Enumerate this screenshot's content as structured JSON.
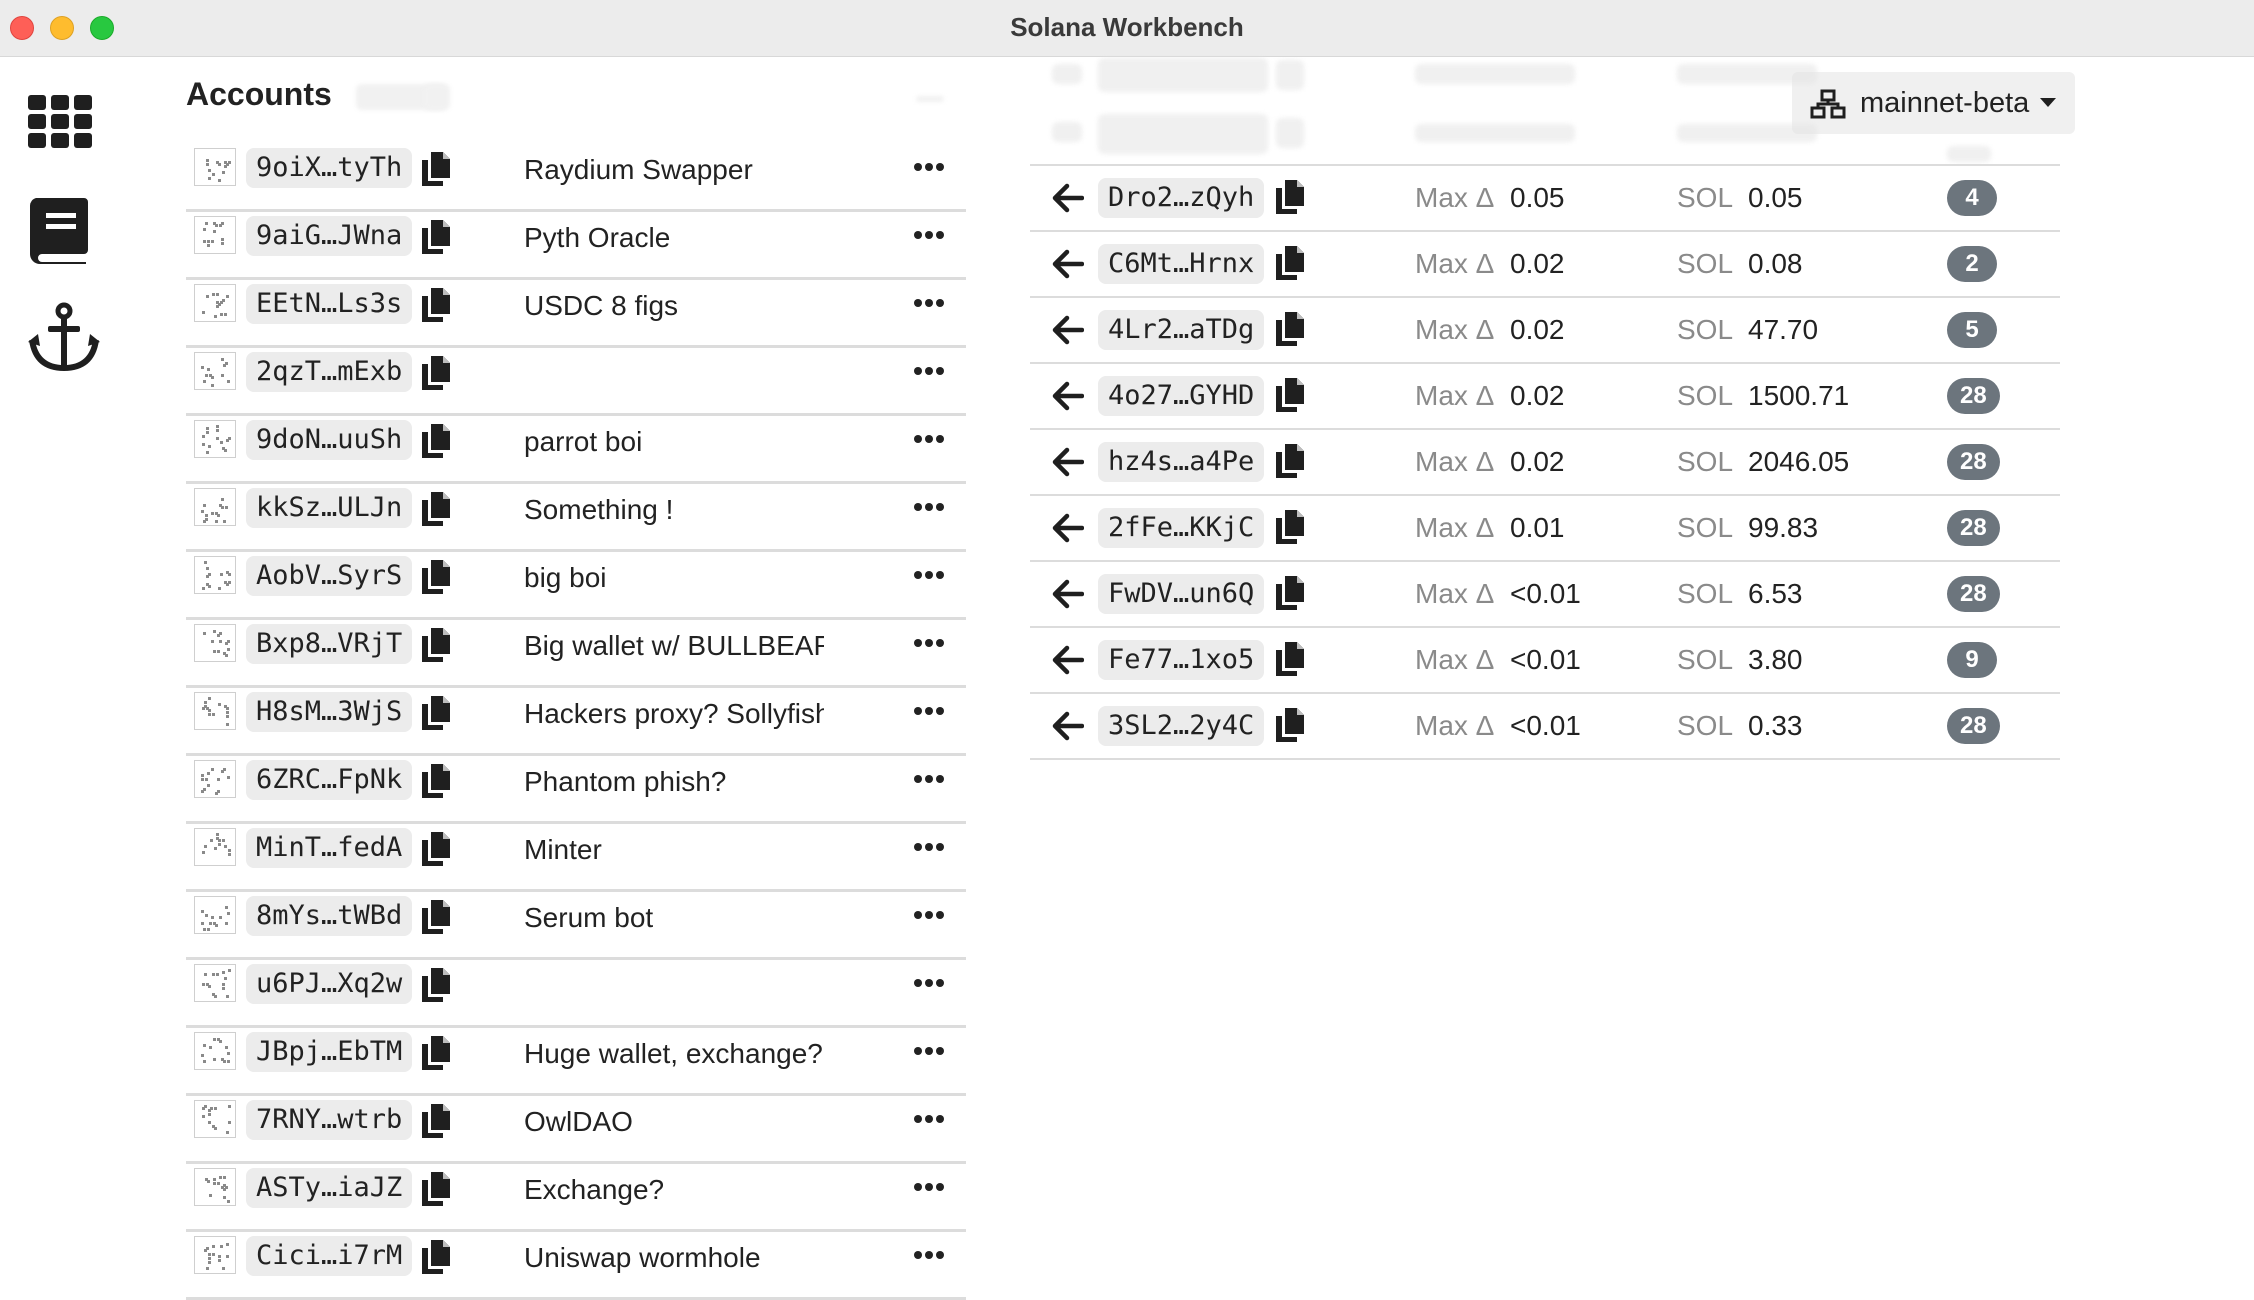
{
  "window": {
    "title": "Solana Workbench"
  },
  "sidebar": {
    "items": [
      {
        "icon": "grid-icon"
      },
      {
        "icon": "book-icon"
      },
      {
        "icon": "anchor-icon"
      }
    ]
  },
  "accounts": {
    "title": "Accounts",
    "rows": [
      {
        "pubkey": "9oiX…tyTh",
        "label": "Raydium Swapper"
      },
      {
        "pubkey": "9aiG…JWna",
        "label": "Pyth Oracle"
      },
      {
        "pubkey": "EEtN…Ls3s",
        "label": "USDC 8 figs"
      },
      {
        "pubkey": "2qzT…mExb",
        "label": ""
      },
      {
        "pubkey": "9doN…uuSh",
        "label": "parrot boi"
      },
      {
        "pubkey": "kkSz…ULJn",
        "label": "Something !"
      },
      {
        "pubkey": "AobV…SyrS",
        "label": "big boi"
      },
      {
        "pubkey": "Bxp8…VRjT",
        "label": "Big wallet w/ BULLBEAR"
      },
      {
        "pubkey": "H8sM…3WjS",
        "label": "Hackers proxy? Sollyfish"
      },
      {
        "pubkey": "6ZRC…FpNk",
        "label": "Phantom phish?"
      },
      {
        "pubkey": "MinT…fedA",
        "label": "Minter"
      },
      {
        "pubkey": "8mYs…tWBd",
        "label": "Serum bot"
      },
      {
        "pubkey": "u6PJ…Xq2w",
        "label": ""
      },
      {
        "pubkey": "JBpj…EbTM",
        "label": "Huge wallet, exchange?"
      },
      {
        "pubkey": "7RNY…wtrb",
        "label": "OwlDAO"
      },
      {
        "pubkey": "ASTy…iaJZ",
        "label": "Exchange?"
      },
      {
        "pubkey": "Cici…i7rM",
        "label": "Uniswap wormhole"
      }
    ]
  },
  "network": {
    "label": "mainnet-beta",
    "icon": "network-icon"
  },
  "transactions": {
    "max_delta_label": "Max Δ",
    "sol_label": "SOL",
    "rows": [
      {
        "pubkey": "Dro2…zQyh",
        "max_delta": "0.05",
        "sol": "0.05",
        "count": "4"
      },
      {
        "pubkey": "C6Mt…Hrnx",
        "max_delta": "0.02",
        "sol": "0.08",
        "count": "2"
      },
      {
        "pubkey": "4Lr2…aTDg",
        "max_delta": "0.02",
        "sol": "47.70",
        "count": "5"
      },
      {
        "pubkey": "4o27…GYHD",
        "max_delta": "0.02",
        "sol": "1500.71",
        "count": "28"
      },
      {
        "pubkey": "hz4s…a4Pe",
        "max_delta": "0.02",
        "sol": "2046.05",
        "count": "28"
      },
      {
        "pubkey": "2fFe…KKjC",
        "max_delta": "0.01",
        "sol": "99.83",
        "count": "28"
      },
      {
        "pubkey": "FwDV…un6Q",
        "max_delta": "<0.01",
        "sol": "6.53",
        "count": "28"
      },
      {
        "pubkey": "Fe77…1xo5",
        "max_delta": "<0.01",
        "sol": "3.80",
        "count": "9"
      },
      {
        "pubkey": "3SL2…2y4C",
        "max_delta": "<0.01",
        "sol": "0.33",
        "count": "28"
      }
    ]
  },
  "colors": {
    "badge": "#6c757d",
    "titlebar": "#ececec",
    "pill": "#ececec"
  }
}
